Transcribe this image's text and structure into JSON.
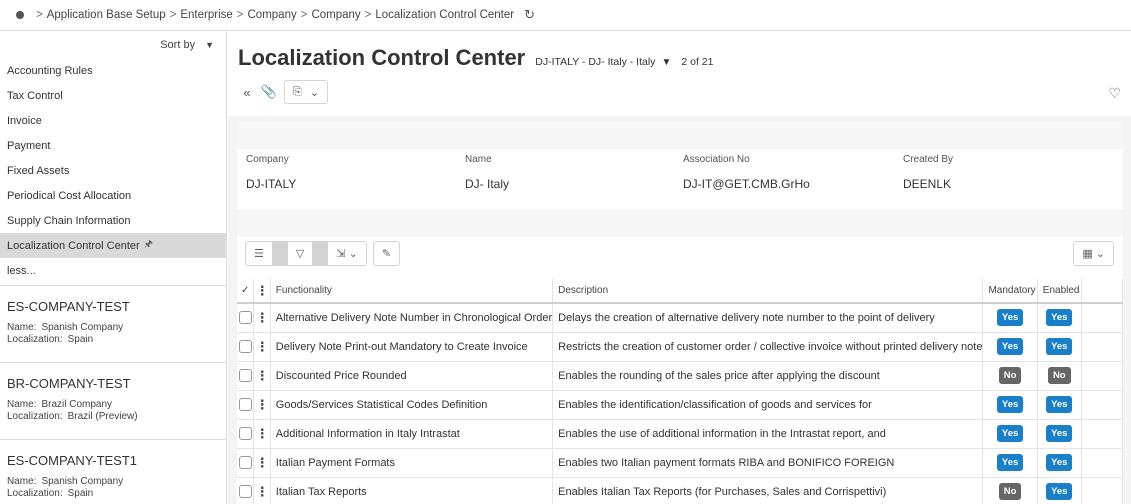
{
  "breadcrumb": {
    "items": [
      "Application Base Setup",
      "Enterprise",
      "Company",
      "Company",
      "Localization Control Center"
    ]
  },
  "sidebar": {
    "sort_label": "Sort by",
    "nav_items": [
      {
        "label": "Accounting Rules"
      },
      {
        "label": "Tax Control"
      },
      {
        "label": "Invoice"
      },
      {
        "label": "Payment"
      },
      {
        "label": "Fixed Assets"
      },
      {
        "label": "Periodical Cost Allocation"
      },
      {
        "label": "Supply Chain Information"
      },
      {
        "label": "Localization Control Center"
      },
      {
        "label": "less..."
      }
    ],
    "cards": [
      {
        "title": "ES-COMPANY-TEST",
        "name_key": "Name:",
        "name": "Spanish Company",
        "loc_key": "Localization:",
        "loc": "Spain"
      },
      {
        "title": "BR-COMPANY-TEST",
        "name_key": "Name:",
        "name": "Brazil Company",
        "loc_key": "Localization:",
        "loc": "Brazil (Preview)"
      },
      {
        "title": "ES-COMPANY-TEST1",
        "name_key": "Name:",
        "name": "Spanish Company",
        "loc_key": "Localization:",
        "loc": "Spain"
      }
    ]
  },
  "header": {
    "title": "Localization Control Center",
    "context": "DJ-ITALY - DJ- Italy - Italy",
    "record_count": "2 of 21"
  },
  "info": {
    "fields": [
      {
        "label": "Company",
        "value": "DJ-ITALY"
      },
      {
        "label": "Name",
        "value": "DJ- Italy"
      },
      {
        "label": "Association No",
        "value": "DJ-IT@GET.CMB.GrHo"
      },
      {
        "label": "Created By",
        "value": "DEENLK"
      }
    ]
  },
  "grid": {
    "headers": {
      "functionality": "Functionality",
      "description": "Description",
      "mandatory": "Mandatory",
      "enabled": "Enabled"
    },
    "rows": [
      {
        "functionality": "Alternative Delivery Note Number in Chronological Order",
        "description": "Delays the creation of alternative delivery note number to the point of delivery",
        "mandatory": "Yes",
        "enabled": "Yes"
      },
      {
        "functionality": "Delivery Note Print-out Mandatory to Create Invoice",
        "description": "Restricts the creation of customer order / collective invoice without printed delivery note",
        "mandatory": "Yes",
        "enabled": "Yes"
      },
      {
        "functionality": "Discounted Price Rounded",
        "description": "Enables the rounding of the sales price after applying the discount",
        "mandatory": "No",
        "enabled": "No"
      },
      {
        "functionality": "Goods/Services Statistical Codes Definition",
        "description": "Enables the identification/classification of goods and services for",
        "mandatory": "Yes",
        "enabled": "Yes"
      },
      {
        "functionality": "Additional Information in Italy Intrastat",
        "description": "Enables the use of additional information in the Intrastat report, and",
        "mandatory": "Yes",
        "enabled": "Yes"
      },
      {
        "functionality": "Italian Payment Formats",
        "description": "Enables two Italian payment formats RIBA and BONIFICO FOREIGN",
        "mandatory": "Yes",
        "enabled": "Yes"
      },
      {
        "functionality": "Italian Tax Reports",
        "description": "Enables Italian Tax Reports (for Purchases, Sales and Corrispettivi)",
        "mandatory": "No",
        "enabled": "Yes"
      }
    ]
  },
  "colors": {
    "yes_badge": "#1a7fc9",
    "no_badge": "#666666",
    "active_nav": "#d9d9d9"
  }
}
